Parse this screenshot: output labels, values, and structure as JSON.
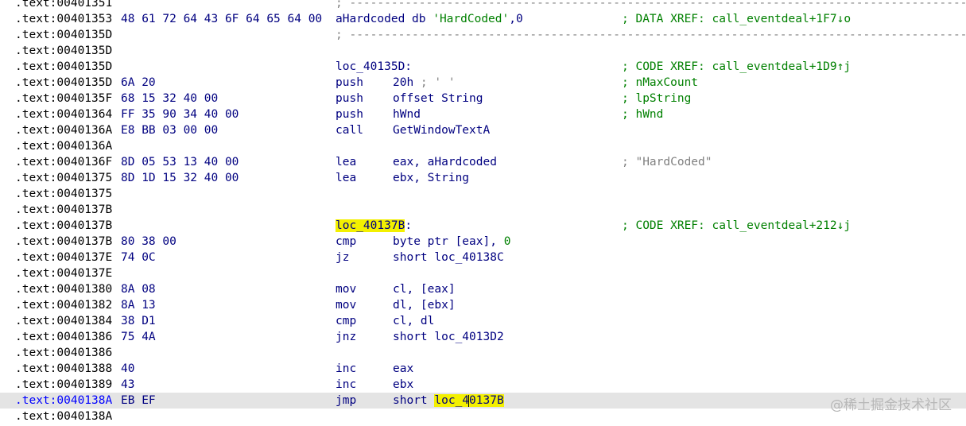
{
  "rows": [
    {
      "addr": ".text:00401351",
      "sep": ";",
      "sep_line": " -----------------------------------------------------------------------------------------"
    },
    {
      "addr": ".text:00401353",
      "bytes": "48 61 72 64 43 6F 64 65 64 00",
      "label": "aHardcoded db ",
      "str": "'HardCoded'",
      "label_tail": ",0",
      "comment": "; DATA XREF: call_eventdeal+1F7↓o"
    },
    {
      "addr": ".text:0040135D",
      "sep": ";",
      "sep_line": " -----------------------------------------------------------------------------------------"
    },
    {
      "addr": ".text:0040135D"
    },
    {
      "addr": ".text:0040135D",
      "label": "loc_40135D:",
      "comment": "; CODE XREF: call_eventdeal+1D9↑j"
    },
    {
      "addr": ".text:0040135D",
      "bytes": "6A 20",
      "mnem": "push",
      "ops": "20h",
      "inline_comment": " ; ' '",
      "comment": "; nMaxCount"
    },
    {
      "addr": ".text:0040135F",
      "bytes": "68 15 32 40 00",
      "mnem": "push",
      "ops": "offset String",
      "comment": "; lpString"
    },
    {
      "addr": ".text:00401364",
      "bytes": "FF 35 90 34 40 00",
      "mnem": "push",
      "ops": "hWnd",
      "comment": "; hWnd"
    },
    {
      "addr": ".text:0040136A",
      "bytes": "E8 BB 03 00 00",
      "mnem": "call",
      "ops": "GetWindowTextA"
    },
    {
      "addr": ".text:0040136A"
    },
    {
      "addr": ".text:0040136F",
      "bytes": "8D 05 53 13 40 00",
      "mnem": "lea",
      "ops": "eax, aHardcoded",
      "comment_gray": "; \"HardCoded\""
    },
    {
      "addr": ".text:00401375",
      "bytes": "8D 1D 15 32 40 00",
      "mnem": "lea",
      "ops": "ebx, String"
    },
    {
      "addr": ".text:00401375"
    },
    {
      "addr": ".text:0040137B"
    },
    {
      "addr": ".text:0040137B",
      "label_hl": "loc_40137B",
      "label_after": ":",
      "comment": "; CODE XREF: call_eventdeal+212↓j"
    },
    {
      "addr": ".text:0040137B",
      "bytes": "80 38 00",
      "mnem": "cmp",
      "ops": "byte ptr [eax], ",
      "ops_num": "0"
    },
    {
      "addr": ".text:0040137E",
      "bytes": "74 0C",
      "mnem": "jz",
      "ops": "short loc_40138C"
    },
    {
      "addr": ".text:0040137E"
    },
    {
      "addr": ".text:00401380",
      "bytes": "8A 08",
      "mnem": "mov",
      "ops": "cl, [eax]"
    },
    {
      "addr": ".text:00401382",
      "bytes": "8A 13",
      "mnem": "mov",
      "ops": "dl, [ebx]"
    },
    {
      "addr": ".text:00401384",
      "bytes": "38 D1",
      "mnem": "cmp",
      "ops": "cl, dl"
    },
    {
      "addr": ".text:00401386",
      "bytes": "75 4A",
      "mnem": "jnz",
      "ops": "short loc_4013D2"
    },
    {
      "addr": ".text:00401386"
    },
    {
      "addr": ".text:00401388",
      "bytes": "40",
      "mnem": "inc",
      "ops": "eax"
    },
    {
      "addr": ".text:00401389",
      "bytes": "43",
      "mnem": "inc",
      "ops": "ebx"
    },
    {
      "addr": ".text:0040138A",
      "bytes": "EB EF",
      "mnem": "jmp",
      "ops": "short ",
      "ops_hl_a": "loc_4",
      "ops_hl_b": "0137B",
      "current": true
    },
    {
      "addr": ".text:0040138A"
    }
  ],
  "watermark": "@稀土掘金技术社区",
  "colors": {
    "address": "#000000",
    "code": "#000080",
    "comment": "#008000",
    "separator": "#808080",
    "highlight": "#f3f000",
    "current_line": "#e4e4e4"
  }
}
